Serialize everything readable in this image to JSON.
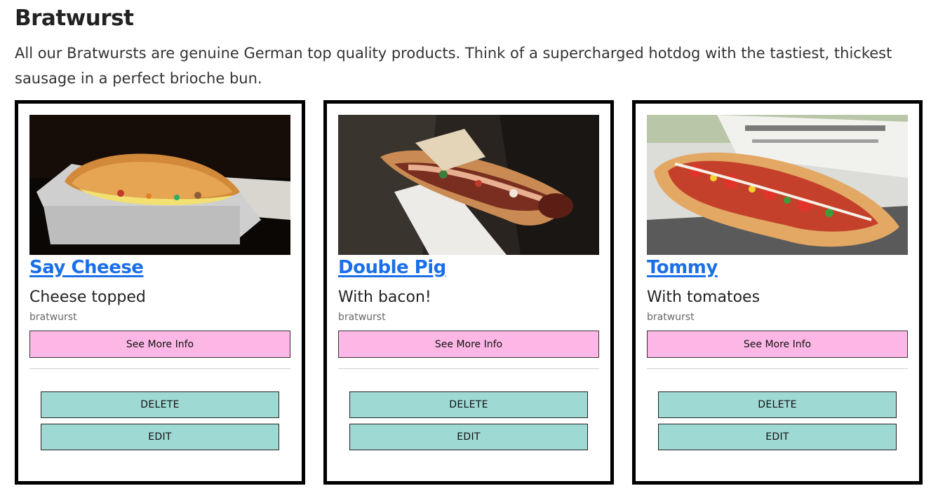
{
  "header": {
    "title": "Bratwurst",
    "intro": "All our Bratwursts are genuine German top quality products. Think of a supercharged hotdog with the tastiest, thickest sausage in a perfect brioche bun."
  },
  "products": [
    {
      "name": "Say Cheese",
      "description": "Cheese topped",
      "category": "bratwurst",
      "info_label": "See More Info",
      "delete_label": "DELETE",
      "edit_label": "EDIT"
    },
    {
      "name": "Double Pig",
      "description": "With bacon!",
      "category": "bratwurst",
      "info_label": "See More Info",
      "delete_label": "DELETE",
      "edit_label": "EDIT"
    },
    {
      "name": "Tommy",
      "description": "With tomatoes",
      "category": "bratwurst",
      "info_label": "See More Info",
      "delete_label": "DELETE",
      "edit_label": "EDIT"
    }
  ],
  "colors": {
    "link": "#1a6fe8",
    "info_button": "#fdb7e6",
    "action_button": "#9fd9d3",
    "card_border": "#000000"
  }
}
